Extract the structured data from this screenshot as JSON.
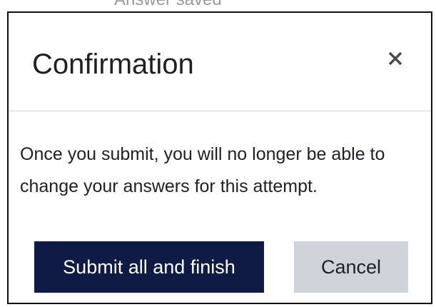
{
  "background": {
    "status_text": "Answer saved"
  },
  "dialog": {
    "title": "Confirmation",
    "close_icon": "close-icon",
    "body_text": "Once you submit, you will no longer be able to change your answers for this attempt.",
    "buttons": {
      "submit_label": "Submit all and finish",
      "cancel_label": "Cancel"
    }
  },
  "colors": {
    "primary_button": "#0f1a45",
    "secondary_button": "#ced4da",
    "text": "#1d2125",
    "divider": "#d6d6d6",
    "modal_border": "#111111"
  }
}
